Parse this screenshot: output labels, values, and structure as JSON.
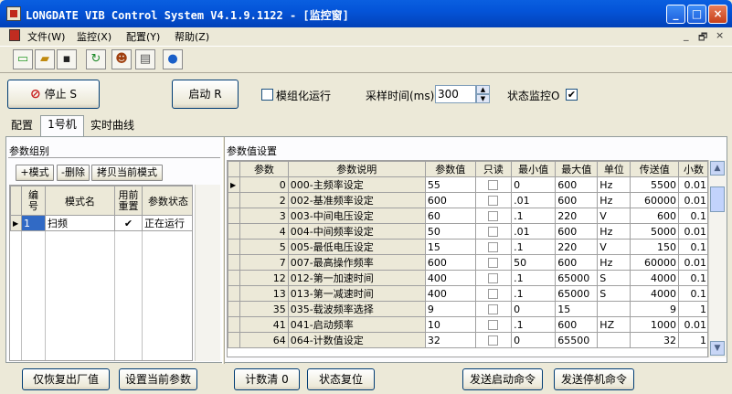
{
  "window": {
    "title": "LONGDATE VIB Control System V4.1.9.1122 - [监控窗]",
    "min": "_",
    "max": "□",
    "close": "×"
  },
  "menu": {
    "items": [
      "文件(W)",
      "监控(X)",
      "配置(Y)",
      "帮助(Z)"
    ],
    "mdi": [
      "_",
      "🗗",
      "×"
    ]
  },
  "toolbar": {
    "icons": [
      "new-file-icon",
      "open-folder-icon",
      "save-icon",
      "refresh-icon",
      "users-icon",
      "clipboard-icon",
      "globe-icon"
    ]
  },
  "controls": {
    "stop_label": "停止 S",
    "start_label": "启动 R",
    "modular_label": "模组化运行",
    "sample_label": "采样时间(ms)",
    "sample_value": "300",
    "status_label": "状态监控O",
    "modular_checked": "",
    "status_checked": "✔"
  },
  "tabs": [
    "配置",
    "1号机",
    "实时曲线"
  ],
  "groups": {
    "title": "参数组别",
    "buttons": [
      "+模式",
      "-删除",
      "拷贝当前模式"
    ],
    "headers": [
      "编号",
      "模式名",
      "用前重置",
      "参数状态"
    ],
    "rows": [
      {
        "id": "1",
        "name": "扫频",
        "reset": "✔",
        "status": "正在运行"
      }
    ]
  },
  "params": {
    "title": "参数值设置",
    "headers": [
      "参数",
      "参数说明",
      "参数值",
      "只读",
      "最小值",
      "最大值",
      "单位",
      "传送值",
      "小数"
    ],
    "rows": [
      {
        "n": "0",
        "desc": "000-主频率设定",
        "val": "55",
        "min": "0",
        "max": "600",
        "unit": "Hz",
        "send": "5500",
        "dec": "0.01"
      },
      {
        "n": "2",
        "desc": "002-基准频率设定",
        "val": "600",
        "min": ".01",
        "max": "600",
        "unit": "Hz",
        "send": "60000",
        "dec": "0.01"
      },
      {
        "n": "3",
        "desc": "003-中间电压设定",
        "val": "60",
        "min": ".1",
        "max": "220",
        "unit": "V",
        "send": "600",
        "dec": "0.1"
      },
      {
        "n": "4",
        "desc": "004-中间频率设定",
        "val": "50",
        "min": ".01",
        "max": "600",
        "unit": "Hz",
        "send": "5000",
        "dec": "0.01"
      },
      {
        "n": "5",
        "desc": "005-最低电压设定",
        "val": "15",
        "min": ".1",
        "max": "220",
        "unit": "V",
        "send": "150",
        "dec": "0.1"
      },
      {
        "n": "7",
        "desc": "007-最高操作频率",
        "val": "600",
        "min": "50",
        "max": "600",
        "unit": "Hz",
        "send": "60000",
        "dec": "0.01"
      },
      {
        "n": "12",
        "desc": "012-第一加速时间",
        "val": "400",
        "min": ".1",
        "max": "65000",
        "unit": "S",
        "send": "4000",
        "dec": "0.1"
      },
      {
        "n": "13",
        "desc": "013-第一减速时间",
        "val": "400",
        "min": ".1",
        "max": "65000",
        "unit": "S",
        "send": "4000",
        "dec": "0.1"
      },
      {
        "n": "35",
        "desc": "035-载波频率选择",
        "val": "9",
        "min": "0",
        "max": "15",
        "unit": "",
        "send": "9",
        "dec": "1"
      },
      {
        "n": "41",
        "desc": "041-启动频率",
        "val": "10",
        "min": ".1",
        "max": "600",
        "unit": "HZ",
        "send": "1000",
        "dec": "0.01"
      },
      {
        "n": "64",
        "desc": "064-计数值设定",
        "val": "32",
        "min": "0",
        "max": "65500",
        "unit": "",
        "send": "32",
        "dec": "1"
      }
    ]
  },
  "bottom": {
    "reset_factory": "仅恢复出厂值",
    "set_current": "设置当前参数",
    "count_clear": "计数清 0",
    "status_reset": "状态复位",
    "send_start": "发送启动命令",
    "send_stop": "发送停机命令"
  }
}
